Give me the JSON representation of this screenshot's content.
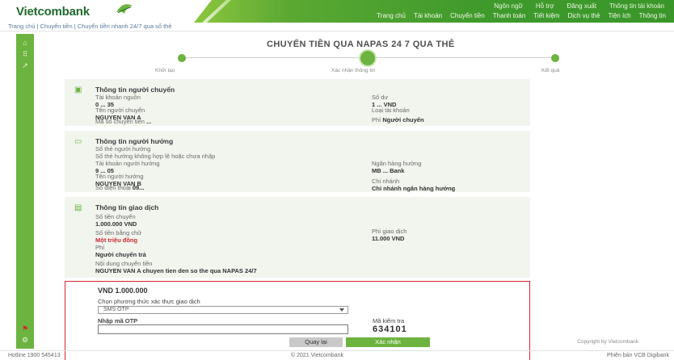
{
  "header": {
    "logo_text": "Vietcombank",
    "top_links": [
      "Ngôn ngữ",
      "Hỗ trợ",
      "Đăng xuất",
      "Thông tin tài khoản"
    ],
    "nav": [
      "Trang chủ",
      "Tài khoản",
      "Chuyển tiền",
      "Thanh toán",
      "Tiết kiệm",
      "Dịch vụ thẻ",
      "Tiện ích",
      "Thông tin"
    ]
  },
  "breadcrumb": "Trang chủ | Chuyển tiền | Chuyển tiền nhanh 24/7 qua số thẻ",
  "page": {
    "title": "CHUYỂN TIỀN QUA NAPAS 24 7 QUA THẺ",
    "steps": [
      "Khởi tạo",
      "Xác nhận thông tin",
      "Kết quả"
    ]
  },
  "sections": {
    "source": {
      "title": "Thông tin người chuyển",
      "f1_label": "Tài khoản nguồn",
      "f1_value": "0 ... 35",
      "f2_label": "Số dư",
      "f2_value": "1 ... VND",
      "f3_label": "Tên người chuyển",
      "f3_value": "NGUYEN VAN A",
      "f4_label": "Loại tài khoản",
      "f5_label": "Mã số chuyển tiền",
      "f5_value": "...",
      "f6_label": "Phí",
      "f6_value": "Người chuyển"
    },
    "receiver": {
      "title": "Thông tin người hưởng",
      "f1_label": "Số thẻ người hưởng",
      "f1_value": "Số thẻ hưởng không hợp lệ hoặc chưa nhập",
      "f2_label": "Tài khoản người hưởng",
      "f2_value": "9 ... 05",
      "f3_label": "Ngân hàng hưởng",
      "f3_value": "MB ... Bank",
      "f4_label": "Tên người hưởng",
      "f4_value": "NGUYEN VAN B",
      "f5_label": "Số điện thoại",
      "f5_value": "09...",
      "f6_label": "Chi nhánh",
      "f6_value": "Chi nhánh ngân hàng hưởng"
    },
    "transaction": {
      "title": "Thông tin giao dịch",
      "f1_label": "Số tiền chuyển",
      "f1_value": "1.000.000 VND",
      "f2_label": "Số tiền bằng chữ",
      "f2_value": "Một triệu đồng",
      "f3_label": "Phí",
      "f3_value": "Người chuyển trả",
      "f4_label": "Nội dung chuyển tiền",
      "f4_value": "NGUYEN VAN A chuyen tien den so the qua NAPAS 24/7",
      "f5_label": "Phí giao dịch",
      "f5_value": "11.000 VND"
    }
  },
  "verify": {
    "amount": "VND 1.000.000",
    "method_label": "Chọn phương thức xác thực giao dịch",
    "method_value": "SMS OTP",
    "otp_label": "Nhập mã OTP",
    "captcha_label": "Mã kiểm tra",
    "captcha_code": "634101"
  },
  "buttons": {
    "back": "Quay lại",
    "confirm": "Xác nhận"
  },
  "footer": {
    "left": "Hotline 1900 545413",
    "center": "© 2021 Vietcombank",
    "right_top": "Copyright by Vietcombank",
    "right": "Phiên bản VCB Digibank"
  },
  "colors": {
    "brand_green": "#6cb33f",
    "verify_border": "#d2272e"
  }
}
